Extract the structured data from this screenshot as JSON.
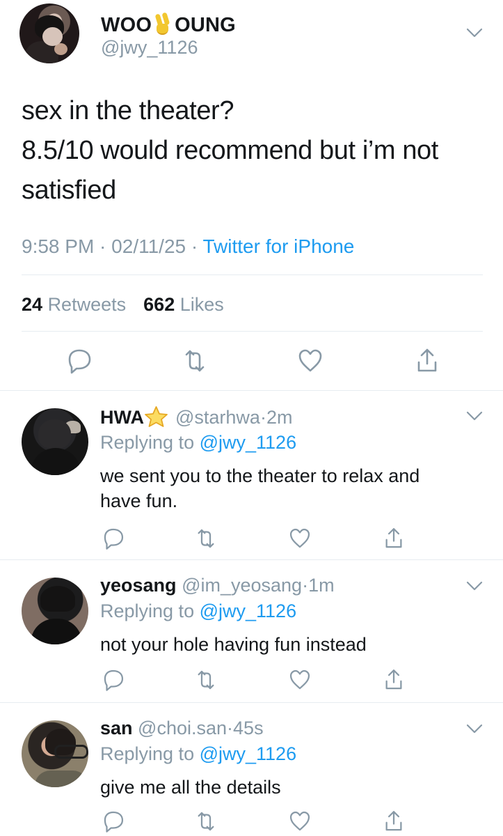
{
  "main_tweet": {
    "name_left": "WOO",
    "name_right": "OUNG",
    "name_icon": "victory-hand-icon",
    "handle": "@jwy_1126",
    "text_lines": [
      "sex in the theater?",
      "8.5/10 would recommend but i’m not",
      "satisfied"
    ],
    "time": "9:58 PM",
    "separator": " · ",
    "date": "02/11/25",
    "source": "Twitter for iPhone",
    "retweets_count": "24",
    "retweets_label": "Retweets",
    "likes_count": "662",
    "likes_label": "Likes",
    "actions": [
      "reply-icon",
      "retweet-icon",
      "like-icon",
      "share-icon"
    ]
  },
  "replies": [
    {
      "name": "HWA",
      "name_icon": "star-icon",
      "handle": "@starhwa",
      "separator": "·",
      "time": "2m",
      "replying_label": "Replying to",
      "replying_handle": "@jwy_1126",
      "text_lines": [
        "we sent you to the theater to relax and",
        "have fun."
      ]
    },
    {
      "name": "yeosang",
      "handle": "@im_yeosang",
      "separator": "·",
      "time": "1m",
      "replying_label": "Replying to",
      "replying_handle": "@jwy_1126",
      "text_lines": [
        "not your hole having fun instead"
      ]
    },
    {
      "name": "san",
      "handle": "@choi.san",
      "separator": "·",
      "time": "45s",
      "replying_label": "Replying to",
      "replying_handle": "@jwy_1126",
      "text_lines": [
        "give me all the details"
      ]
    }
  ],
  "colors": {
    "link": "#1d9bf0",
    "secondary_text": "#8899a6",
    "primary_text": "#14171a",
    "divider": "#e6ecf0",
    "star": "#f7d14a"
  },
  "icons": {
    "chevron": "chevron-down-icon",
    "reply": "reply-icon",
    "retweet": "retweet-icon",
    "like": "like-icon",
    "share": "share-icon"
  }
}
